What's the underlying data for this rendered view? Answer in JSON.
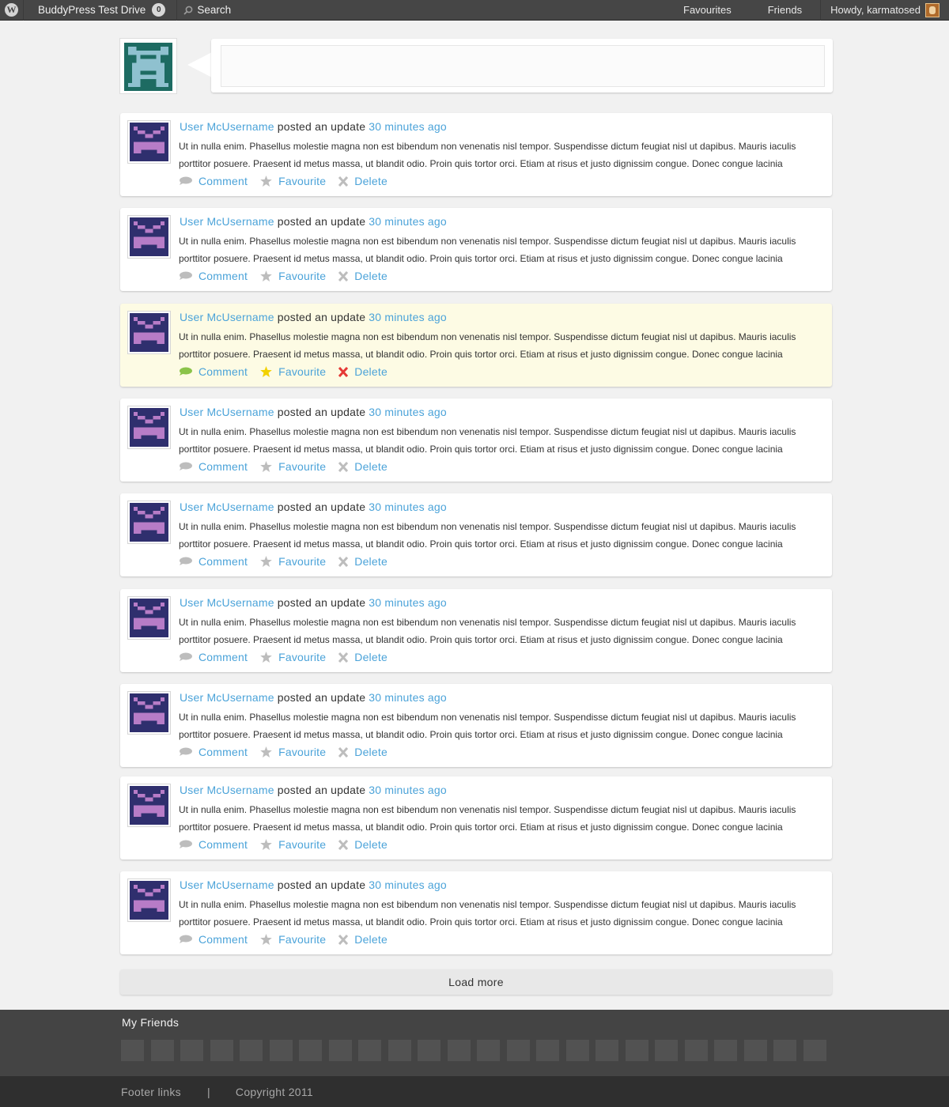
{
  "admin_bar": {
    "site_name": "BuddyPress Test Drive",
    "notification_count": "0",
    "search_label": "Search",
    "favourites_label": "Favourites",
    "friends_label": "Friends",
    "howdy_text": "Howdy, karmatosed"
  },
  "post_box": {
    "input_value": ""
  },
  "activity": {
    "items": [
      {
        "user": "User McUsername",
        "verb": "posted an update",
        "time": "30 minutes ago",
        "body": "Ut in nulla enim. Phasellus molestie magna non est bibendum non venenatis nisl tempor. Suspendisse dictum feugiat nisl ut dapibus. Mauris iaculis porttitor posuere. Praesent id metus massa, ut blandit odio. Proin quis tortor orci. Etiam at risus et justo dignissim congue. Donec congue lacinia",
        "comment": "Comment",
        "favourite": "Favourite",
        "delete": "Delete"
      },
      {
        "user": "User McUsername",
        "verb": "posted an update",
        "time": "30 minutes ago",
        "body": "Ut in nulla enim. Phasellus molestie magna non est bibendum non venenatis nisl tempor. Suspendisse dictum feugiat nisl ut dapibus. Mauris iaculis porttitor posuere. Praesent id metus massa, ut blandit odio. Proin quis tortor orci. Etiam at risus et justo dignissim congue. Donec congue lacinia",
        "comment": "Comment",
        "favourite": "Favourite",
        "delete": "Delete"
      },
      {
        "user": "User McUsername",
        "verb": "posted an update",
        "time": "30 minutes ago",
        "body": "Ut in nulla enim. Phasellus molestie magna non est bibendum non venenatis nisl tempor. Suspendisse dictum feugiat nisl ut dapibus. Mauris iaculis porttitor posuere. Praesent id metus massa, ut blandit odio. Proin quis tortor orci. Etiam at risus et justo dignissim congue. Donec congue lacinia",
        "comment": "Comment",
        "favourite": "Favourite",
        "delete": "Delete"
      },
      {
        "user": "User McUsername",
        "verb": "posted an update",
        "time": "30 minutes ago",
        "body": "Ut in nulla enim. Phasellus molestie magna non est bibendum non venenatis nisl tempor. Suspendisse dictum feugiat nisl ut dapibus. Mauris iaculis porttitor posuere. Praesent id metus massa, ut blandit odio. Proin quis tortor orci. Etiam at risus et justo dignissim congue. Donec congue lacinia",
        "comment": "Comment",
        "favourite": "Favourite",
        "delete": "Delete"
      },
      {
        "user": "User McUsername",
        "verb": "posted an update",
        "time": "30 minutes ago",
        "body": "Ut in nulla enim. Phasellus molestie magna non est bibendum non venenatis nisl tempor. Suspendisse dictum feugiat nisl ut dapibus. Mauris iaculis porttitor posuere. Praesent id metus massa, ut blandit odio. Proin quis tortor orci. Etiam at risus et justo dignissim congue. Donec congue lacinia",
        "comment": "Comment",
        "favourite": "Favourite",
        "delete": "Delete"
      },
      {
        "user": "User McUsername",
        "verb": "posted an update",
        "time": "30 minutes ago",
        "body": "Ut in nulla enim. Phasellus molestie magna non est bibendum non venenatis nisl tempor. Suspendisse dictum feugiat nisl ut dapibus. Mauris iaculis porttitor posuere. Praesent id metus massa, ut blandit odio. Proin quis tortor orci. Etiam at risus et justo dignissim congue. Donec congue lacinia",
        "comment": "Comment",
        "favourite": "Favourite",
        "delete": "Delete"
      },
      {
        "user": "User McUsername",
        "verb": "posted an update",
        "time": "30 minutes ago",
        "body": "Ut in nulla enim. Phasellus molestie magna non est bibendum non venenatis nisl tempor. Suspendisse dictum feugiat nisl ut dapibus. Mauris iaculis porttitor posuere. Praesent id metus massa, ut blandit odio. Proin quis tortor orci. Etiam at risus et justo dignissim congue. Donec congue lacinia",
        "comment": "Comment",
        "favourite": "Favourite",
        "delete": "Delete"
      },
      {
        "user": "User McUsername",
        "verb": "posted an update",
        "time": "30 minutes ago",
        "body": "Ut in nulla enim. Phasellus molestie magna non est bibendum non venenatis nisl tempor. Suspendisse dictum feugiat nisl ut dapibus. Mauris iaculis porttitor posuere. Praesent id metus massa, ut blandit odio. Proin quis tortor orci. Etiam at risus et justo dignissim congue. Donec congue lacinia",
        "comment": "Comment",
        "favourite": "Favourite",
        "delete": "Delete"
      },
      {
        "user": "User McUsername",
        "verb": "posted an update",
        "time": "30 minutes ago",
        "body": "Ut in nulla enim. Phasellus molestie magna non est bibendum non venenatis nisl tempor. Suspendisse dictum feugiat nisl ut dapibus. Mauris iaculis porttitor posuere. Praesent id metus massa, ut blandit odio. Proin quis tortor orci. Etiam at risus et justo dignissim congue. Donec congue lacinia",
        "comment": "Comment",
        "favourite": "Favourite",
        "delete": "Delete"
      }
    ]
  },
  "load_more_label": "Load more",
  "friends": {
    "title": "My Friends"
  },
  "footer": {
    "links_label": "Footer links",
    "separator": "|",
    "copyright": "Copyright 2011"
  },
  "colors": {
    "link_blue": "#4ba3d9",
    "highlight_bg": "#fdfbe4",
    "admin_bar_bg": "#464646"
  }
}
